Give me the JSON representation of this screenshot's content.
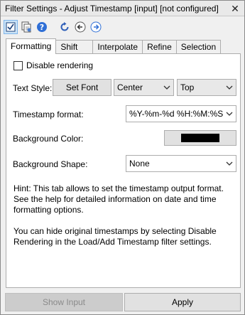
{
  "window": {
    "title": "Filter Settings - Adjust Timestamp [input] [not configured]",
    "close_glyph": "✕"
  },
  "toolbar": {
    "icons": [
      "checkbox-toggle-icon",
      "copy-settings-icon",
      "help-icon",
      "refresh-icon",
      "back-icon",
      "forward-icon"
    ]
  },
  "tabs": [
    {
      "label": "Formatting",
      "active": true
    },
    {
      "label": "Shift"
    },
    {
      "label": "Interpolate"
    },
    {
      "label": "Refine"
    },
    {
      "label": "Selection"
    }
  ],
  "formatting": {
    "disable_rendering_label": "Disable rendering",
    "disable_rendering_checked": false,
    "text_style_label": "Text Style:",
    "set_font_label": "Set Font",
    "alignment_value": "Center",
    "position_value": "Top",
    "timestamp_format_label": "Timestamp format:",
    "timestamp_format_value": "%Y-%m-%d %H:%M:%S",
    "background_color_label": "Background Color:",
    "background_color": "#000000",
    "background_shape_label": "Background Shape:",
    "background_shape_value": "None"
  },
  "hint": {
    "paragraph1": "Hint: This tab allows to set the timestamp output format. See the help for detailed information on date and time formatting options.",
    "paragraph2": "You can hide original timestamps by selecting Disable Rendering in the Load/Add Timestamp filter settings."
  },
  "bottom": {
    "show_input_label": "Show Input",
    "apply_label": "Apply"
  }
}
